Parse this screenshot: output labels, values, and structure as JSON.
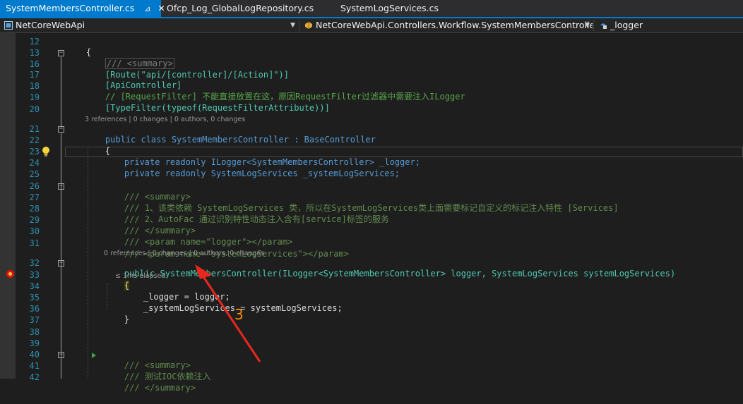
{
  "tabs": [
    {
      "label": "SystemMembersController.cs",
      "active": true
    },
    {
      "label": "Ofcp_Log_GlobalLogRepository.cs",
      "active": false
    },
    {
      "label": "SystemLogServices.cs",
      "active": false
    }
  ],
  "navbar": {
    "project": "NetCoreWebApi",
    "type": "NetCoreWebApi.Controllers.Workflow.SystemMembersController",
    "member": "_logger"
  },
  "colors": {
    "accent": "#007acc",
    "keyword": "#569cd6",
    "type": "#4ec9b0",
    "comment": "#57a64a",
    "string": "#d69d85",
    "lineNumber": "#2b91af",
    "annotation": "#ff8c00",
    "arrow": "#e8281e"
  },
  "icons": {
    "pin": "pin-icon",
    "close": "close-icon",
    "project": "csharp-project-icon",
    "type": "class-icon",
    "member": "field-icon",
    "lightbulb": "lightbulb-icon",
    "breakpoint": "breakpoint-icon"
  },
  "editor": {
    "lines": [
      {
        "n": "12",
        "text": "{"
      },
      {
        "n": "13",
        "text": "/// <summary>"
      },
      {
        "n": "16",
        "text": "[Route(\"api/[controller]/[Action]\")]"
      },
      {
        "n": "17",
        "text": "[ApiController]"
      },
      {
        "n": "18",
        "text": "// [RequestFilter] 不能直接放置在这，原因RequestFilter过滤器中需要注入ILogger"
      },
      {
        "n": "19",
        "text": "[TypeFilter(typeof(RequestFilterAttribute))]"
      },
      {
        "n": "20",
        "text": ""
      },
      {
        "n": "21",
        "text": "public class SystemMembersController : BaseController"
      },
      {
        "n": "22",
        "text": "{"
      },
      {
        "n": "23",
        "text": "private readonly ILogger<SystemMembersController> _logger;"
      },
      {
        "n": "24",
        "text": "private readonly SystemLogServices _systemLogServices;"
      },
      {
        "n": "25",
        "text": ""
      },
      {
        "n": "26",
        "text": "/// <summary>"
      },
      {
        "n": "27",
        "text": "/// 1、该类依赖 SystemLogServices 类，所以在SystemLogServices类上面需要标记自定义的标记注入特性 [Services]"
      },
      {
        "n": "28",
        "text": "/// 2、AutoFac 通过识别特性动态注入含有[service]标签的服务"
      },
      {
        "n": "29",
        "text": "/// </summary>"
      },
      {
        "n": "30",
        "text": "/// <param name=\"logger\"></param>"
      },
      {
        "n": "31",
        "text": "/// <param name=\"systemLogServices\"></param>"
      },
      {
        "n": "32",
        "text": "public SystemMembersController(ILogger<SystemMembersController> logger, SystemLogServices systemLogServices)"
      },
      {
        "n": "33",
        "text": "{"
      },
      {
        "n": "34",
        "text": "_logger = logger;"
      },
      {
        "n": "35",
        "text": "_systemLogServices = systemLogServices;"
      },
      {
        "n": "36",
        "text": "}"
      },
      {
        "n": "37",
        "text": ""
      },
      {
        "n": "38",
        "text": ""
      },
      {
        "n": "39",
        "text": ""
      },
      {
        "n": "40",
        "text": "/// <summary>"
      },
      {
        "n": "41",
        "text": "/// 测试IOC依赖注入"
      },
      {
        "n": "42",
        "text": "/// </summary>"
      }
    ],
    "codelens_class": "3 references | 0 changes | 0 authors, 0 changes",
    "codelens_ctor": "0 references | 0 changes | 0 authors, 0 changes",
    "elapsed": "≤ 1ms elapsed"
  },
  "annotation": {
    "label": "3"
  }
}
